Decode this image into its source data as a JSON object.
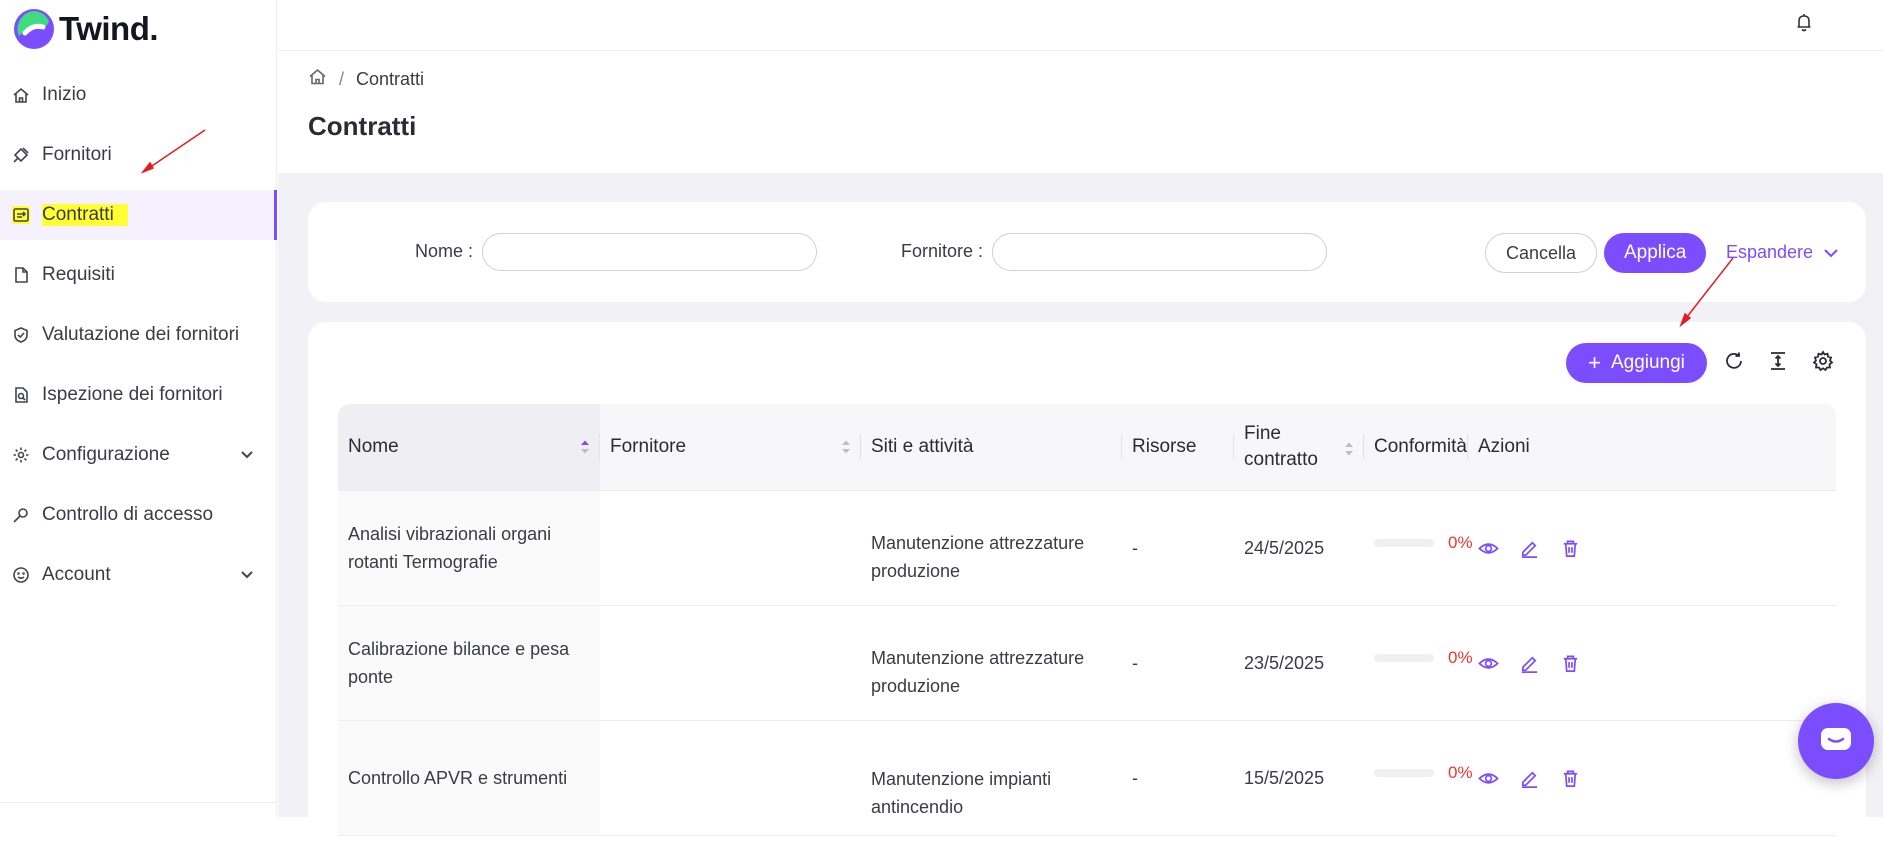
{
  "app": {
    "logo_text": "Twind."
  },
  "sidebar": {
    "items": [
      {
        "label": "Inizio",
        "icon": "home-icon"
      },
      {
        "label": "Fornitori",
        "icon": "plug-icon"
      },
      {
        "label": "Contratti",
        "icon": "contract-icon",
        "active": true
      },
      {
        "label": "Requisiti",
        "icon": "file-icon"
      },
      {
        "label": "Valutazione dei fornitori",
        "icon": "shield-check-icon"
      },
      {
        "label": "Ispezione dei fornitori",
        "icon": "file-search-icon"
      },
      {
        "label": "Configurazione",
        "icon": "gear-icon",
        "expandable": true
      },
      {
        "label": "Controllo di accesso",
        "icon": "key-icon"
      },
      {
        "label": "Account",
        "icon": "smile-icon",
        "expandable": true
      }
    ]
  },
  "breadcrumb": {
    "current": "Contratti",
    "separator": "/"
  },
  "page": {
    "title": "Contratti"
  },
  "filters": {
    "name_label": "Nome",
    "name_value": "",
    "supplier_label": "Fornitore",
    "supplier_value": "",
    "cancel_label": "Cancella",
    "apply_label": "Applica",
    "expand_label": "Espandere"
  },
  "toolbar": {
    "add_label": "Aggiungi"
  },
  "table": {
    "columns": [
      "Nome",
      "Fornitore",
      "Siti e attività",
      "Risorse",
      "Fine contratto",
      "Conformità",
      "Azioni"
    ],
    "rows": [
      {
        "nome": "Analisi vibrazionali organi rotanti Termografie",
        "fornitore": "",
        "siti": "Manutenzione attrezzature produzione",
        "risorse": "-",
        "fine": "24/5/2025",
        "conformita": "0%",
        "conformita_value": 0
      },
      {
        "nome": "Calibrazione bilance e pesa ponte",
        "fornitore": "",
        "siti": "Manutenzione attrezzature produzione",
        "risorse": "-",
        "fine": "23/5/2025",
        "conformita": "0%",
        "conformita_value": 0
      },
      {
        "nome": "Controllo APVR e strumenti",
        "fornitore": "",
        "siti": "Manutenzione impianti antincendio",
        "risorse": "-",
        "fine": "15/5/2025",
        "conformita": "0%",
        "conformita_value": 0
      }
    ]
  },
  "colors": {
    "accent": "#7c4dff",
    "highlight": "#ffff33",
    "danger": "#e53935",
    "annotation_arrow": "#e02020"
  }
}
